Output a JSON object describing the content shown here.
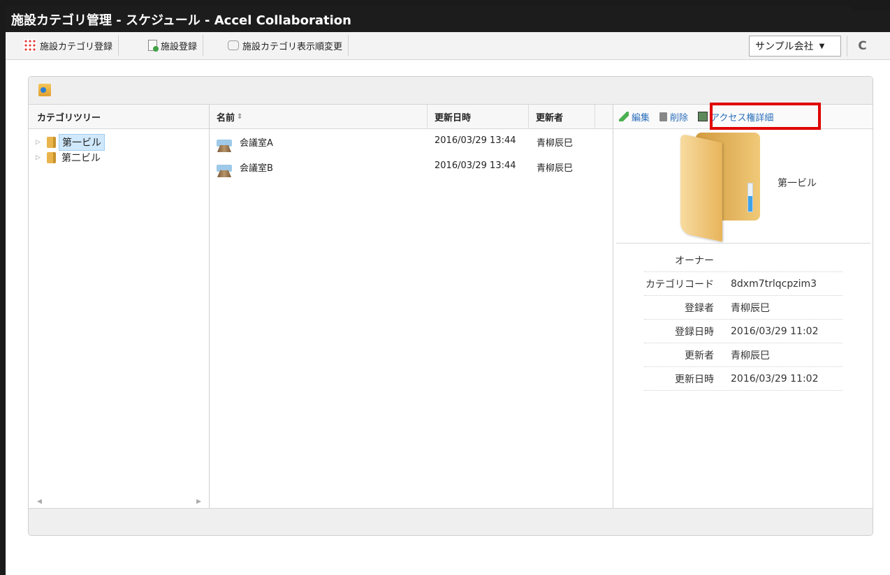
{
  "window": {
    "title": "施設カテゴリ管理 - スケジュール - Accel Collaboration"
  },
  "toolbar": {
    "btn_category_register": "施設カテゴリ登録",
    "btn_facility_register": "施設登録",
    "btn_category_order": "施設カテゴリ表示順変更",
    "company_select": "サンプル会社",
    "refresh_icon": "C"
  },
  "tree": {
    "header": "カテゴリツリー",
    "items": [
      {
        "label": "第一ビル",
        "selected": true
      },
      {
        "label": "第二ビル",
        "selected": false
      }
    ]
  },
  "list": {
    "headers": {
      "name": "名前",
      "sort_icon": "⇕",
      "updated_at": "更新日時",
      "updated_by": "更新者"
    },
    "rows": [
      {
        "name": "会議室A",
        "updated_at": "2016/03/29 13:44",
        "updated_by": "青柳辰巳"
      },
      {
        "name": "会議室B",
        "updated_at": "2016/03/29 13:44",
        "updated_by": "青柳辰巳"
      }
    ]
  },
  "detail": {
    "actions": {
      "edit": "編集",
      "delete": "削除",
      "access": "アクセス権詳細"
    },
    "folder_name": "第一ビル",
    "gauge_fraction": 0.55,
    "props": [
      {
        "k": "オーナー",
        "v": ""
      },
      {
        "k": "カテゴリコード",
        "v": "8dxm7trlqcpzim3"
      },
      {
        "k": "登録者",
        "v": "青柳辰巳"
      },
      {
        "k": "登録日時",
        "v": "2016/03/29 11:02"
      },
      {
        "k": "更新者",
        "v": "青柳辰巳"
      },
      {
        "k": "更新日時",
        "v": "2016/03/29 11:02"
      }
    ]
  },
  "colors": {
    "highlight": "#e00000",
    "link": "#2a6ebb",
    "selected": "#cfe8fb"
  }
}
